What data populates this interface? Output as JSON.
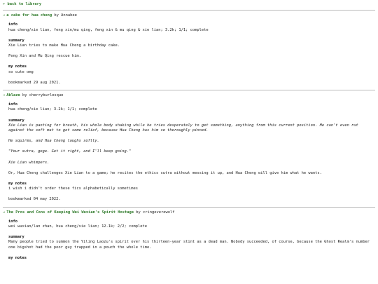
{
  "nav": {
    "back_label": "← back to library"
  },
  "labels": {
    "info": "info",
    "summary": "summary",
    "my_notes": "my notes",
    "by": "by"
  },
  "entries": [
    {
      "title": "a cake for hua cheng",
      "author": "Annabee",
      "info": "hua cheng/xie lian, feng xin/mu qing, feng xin & mu qing & xie lian; 3.2k; 1/1; complete",
      "summary": [
        "Xie Lian tries to make Hua Cheng a birthday cake.",
        "Feng Xin and Mu Qing rescue him."
      ],
      "notes": "so cute omg",
      "bookmarked": "bookmarked 29 aug 2021."
    },
    {
      "title": "Ablaze",
      "author": "cherryburlesque",
      "info": "hua cheng/xie lian; 3.2k; 1/1; complete",
      "summary": [
        "Xie Lian is panting for breath, his whole body shaking while he tries desperately to get something, anything from this current position. He can't even rut against the soft mat to get some relief, because Hua Cheng has him so thoroughly pinned.",
        "He squirms, and Hua Cheng laughs softly.",
        "\"Your sutra, gege. Get it right, and I'll keep going.\"",
        "Xie Lian whimpers.",
        "Or, Hua Cheng challenges Xie Lian to a game; he recites the ethics sutra without messing it up, and Hua Cheng will give him what he wants."
      ],
      "notes": "i wish i didn't order these fics alphabetically sometimes",
      "bookmarked": "bookmarked 04 may 2022."
    },
    {
      "title": "The Pros and Cons of Keeping Wei Wuxian's Spirit Hostage",
      "author": "cringeverewolf",
      "info": "wei wuxian/lan zhan, hua cheng/xie lian; 12.1k; 2/2; complete",
      "summary": [
        "Many people tried to summon the Yiling Laozu's spirit over his thirteen-year stint as a dead man. Nobody succeeded, of course, because the Ghost Realm's number one bigshot had the poor guy trapped in a pouch the whole time."
      ],
      "notes": "",
      "bookmarked": ""
    }
  ],
  "colors": {
    "link": "#2f7a2a",
    "divider": "#bbbbbb",
    "text": "#222222"
  }
}
